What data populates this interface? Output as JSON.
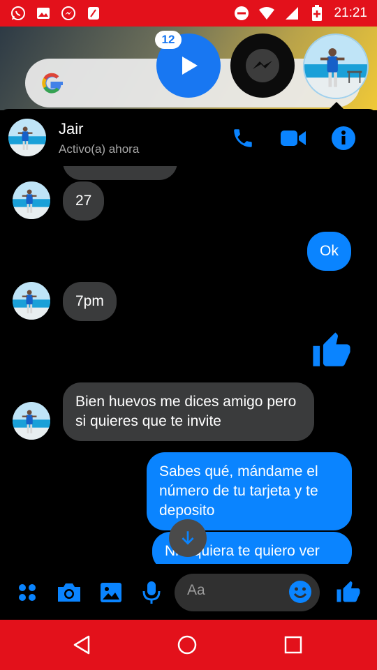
{
  "status_bar": {
    "time": "21:21",
    "left_icons": [
      "whatsapp-icon",
      "gallery-icon",
      "messenger-icon",
      "app-icon"
    ],
    "right_icons": [
      "dnd-icon",
      "wifi-icon",
      "signal-icon",
      "battery-icon"
    ]
  },
  "bubble_heads": {
    "notification_count": "12"
  },
  "header": {
    "name": "Jair",
    "status": "Activo(a) ahora"
  },
  "messages": [
    {
      "side": "in",
      "text": "27"
    },
    {
      "side": "out",
      "text": "Ok"
    },
    {
      "side": "in",
      "text": "7pm"
    },
    {
      "side": "out",
      "type": "like"
    },
    {
      "side": "in",
      "text": "Bien huevos me dices amigo pero si quieres que te invite"
    },
    {
      "side": "out",
      "text": "Sabes qué, mándame el número de tu tarjeta y te deposito"
    },
    {
      "side": "out",
      "text": "Ni siquiera te quiero ver"
    }
  ],
  "composer": {
    "placeholder": "Aa"
  },
  "colors": {
    "accent": "#0a84ff",
    "status_bar": "#e3111b",
    "incoming_bubble": "#3a3b3c"
  }
}
